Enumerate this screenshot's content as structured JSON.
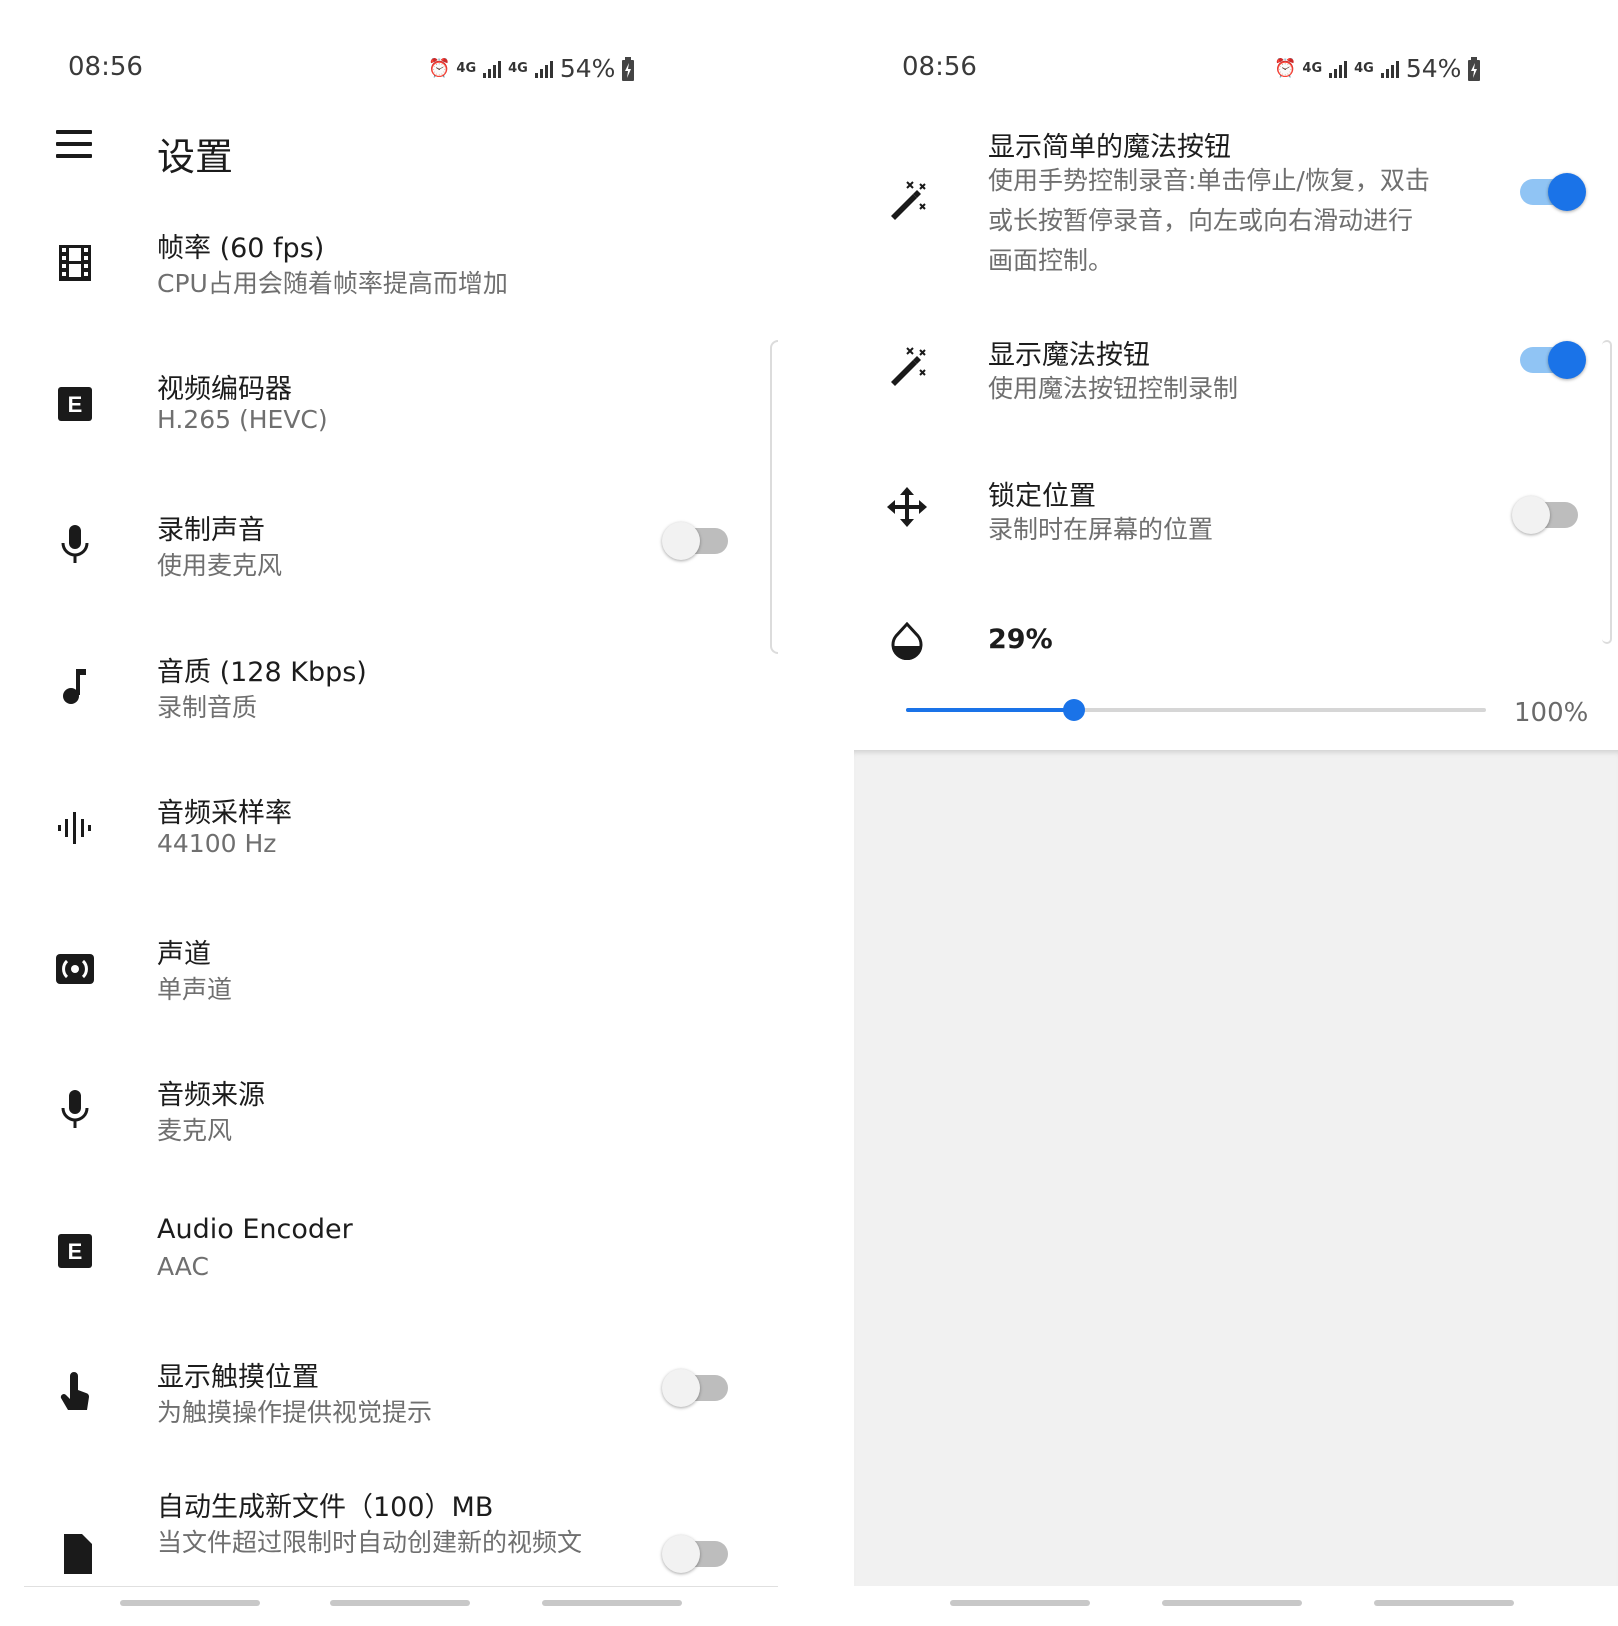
{
  "status": {
    "time": "08:56",
    "net1": "4G",
    "net2": "4G",
    "battery": "54%"
  },
  "left": {
    "title": "设置",
    "items": [
      {
        "title": "帧率 (60 fps)",
        "subtitle": "CPU占用会随着帧率提高而增加",
        "icon": "film-icon"
      },
      {
        "title": "视频编码器",
        "subtitle": "H.265 (HEVC)",
        "icon": "encoder-icon"
      },
      {
        "title": "录制声音",
        "subtitle": "使用麦克风",
        "icon": "mic-icon",
        "toggle": false
      },
      {
        "title": "音质 (128 Kbps)",
        "subtitle": "录制音质",
        "icon": "music-note-icon"
      },
      {
        "title": "音频采样率",
        "subtitle": "44100 Hz",
        "icon": "waveform-icon"
      },
      {
        "title": "声道",
        "subtitle": "单声道",
        "icon": "surround-icon"
      },
      {
        "title": "音频来源",
        "subtitle": "麦克风",
        "icon": "mic-icon"
      },
      {
        "title": "Audio Encoder",
        "subtitle": "AAC",
        "icon": "encoder-icon"
      },
      {
        "title": "显示触摸位置",
        "subtitle": "为触摸操作提供视觉提示",
        "icon": "touch-icon",
        "toggle": false
      },
      {
        "title": "自动生成新文件（100）MB",
        "subtitle": "当文件超过限制时自动创建新的视频文",
        "icon": "file-icon",
        "toggle": false
      }
    ]
  },
  "right": {
    "items": [
      {
        "title": "显示简单的魔法按钮",
        "subtitle_lines": [
          "使用手势控制录音:单击停止/恢复，双击",
          "或长按暂停录音，向左或向右滑动进行",
          "画面控制。"
        ],
        "icon": "magic-wand-icon",
        "toggle": true
      },
      {
        "title": "显示魔法按钮",
        "subtitle_lines": [
          "使用魔法按钮控制录制"
        ],
        "icon": "magic-wand-icon",
        "toggle": true
      },
      {
        "title": "锁定位置",
        "subtitle_lines": [
          "录制时在屏幕的位置"
        ],
        "icon": "move-icon",
        "toggle": false
      }
    ],
    "opacity": {
      "value_label": "29%",
      "value": 29,
      "max_label": "100%",
      "icon": "opacity-drop-icon"
    }
  },
  "colors": {
    "accent": "#1a73e8",
    "accent_track": "#90c4f4",
    "switch_off_track": "#bdbdbd",
    "subtitle": "#6f6f6f",
    "empty_area": "#f1f1f1"
  }
}
